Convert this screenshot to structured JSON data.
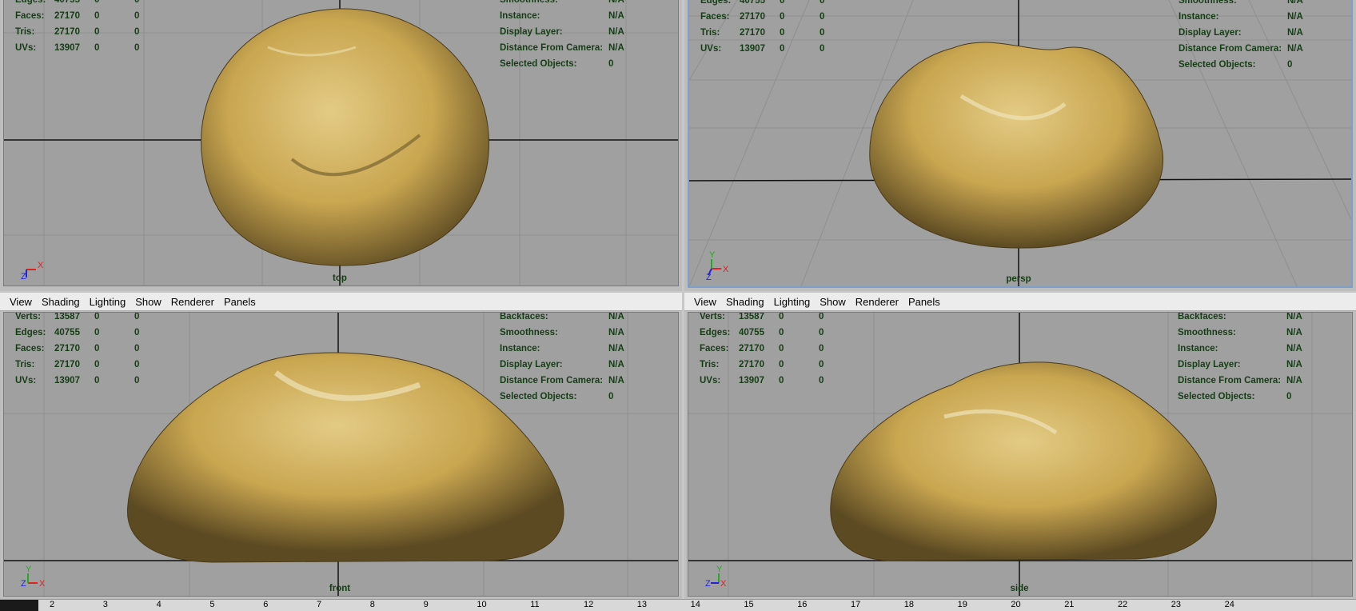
{
  "menu": [
    "View",
    "Shading",
    "Lighting",
    "Show",
    "Renderer",
    "Panels"
  ],
  "hud_left": [
    {
      "label": "Verts:",
      "v1": "13587",
      "v2": "0",
      "v3": "0"
    },
    {
      "label": "Edges:",
      "v1": "40755",
      "v2": "0",
      "v3": "0"
    },
    {
      "label": "Faces:",
      "v1": "27170",
      "v2": "0",
      "v3": "0"
    },
    {
      "label": "Tris:",
      "v1": "27170",
      "v2": "0",
      "v3": "0"
    },
    {
      "label": "UVs:",
      "v1": "13907",
      "v2": "0",
      "v3": "0"
    }
  ],
  "hud_right": [
    {
      "label": "Backfaces:",
      "value": "N/A"
    },
    {
      "label": "Smoothness:",
      "value": "N/A"
    },
    {
      "label": "Instance:",
      "value": "N/A"
    },
    {
      "label": "Display Layer:",
      "value": "N/A"
    },
    {
      "label": "Distance From Camera:",
      "value": "N/A"
    },
    {
      "label": "Selected Objects:",
      "value": "0"
    }
  ],
  "panels": {
    "top": {
      "camera": "top"
    },
    "persp": {
      "camera": "persp"
    },
    "front": {
      "camera": "front"
    },
    "side": {
      "camera": "side"
    }
  },
  "axis_labels": {
    "x": "X",
    "y": "Y",
    "z": "Z"
  },
  "timeline": [
    "2",
    "3",
    "4",
    "5",
    "6",
    "7",
    "8",
    "9",
    "10",
    "11",
    "12",
    "13",
    "14",
    "15",
    "16",
    "17",
    "18",
    "19",
    "20",
    "21",
    "22",
    "23",
    "24"
  ],
  "colors": {
    "viewport_bg": "#a0a0a0",
    "grid": "#8f8f8f",
    "axis_line": "#111111",
    "hud_text": "#153d15",
    "rock_base": "#c9a650",
    "rock_light": "#e3cb85",
    "rock_dark": "#5c4a22",
    "active_border": "#7e9fc9"
  }
}
